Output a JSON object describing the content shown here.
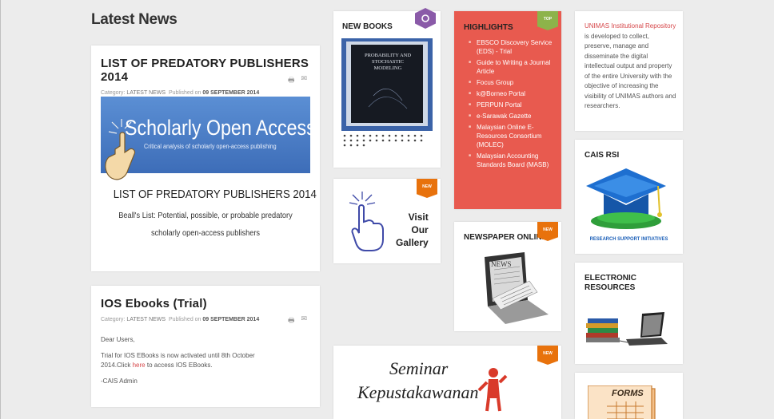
{
  "section_title": "Latest News",
  "articles": [
    {
      "title": "LIST OF PREDATORY PUBLISHERS 2014",
      "category_label": "Category:",
      "category": "LATEST NEWS",
      "published_label": "Published on",
      "date": "09 SEPTEMBER 2014",
      "image": {
        "banner_title": "Scholarly Open Access",
        "banner_subtitle": "Critical analysis of scholarly open-access publishing",
        "heading": "LIST OF PREDATORY PUBLISHERS 2014",
        "line1": "Beall's List: Potential, possible, or probable predatory",
        "line2": "scholarly open-access publishers"
      }
    },
    {
      "title": "IOS Ebooks (Trial)",
      "category_label": "Category:",
      "category": "LATEST NEWS",
      "published_label": "Published on",
      "date": "09 SEPTEMBER 2014",
      "greeting": "Dear Users,",
      "body_before": "Trial for IOS EBooks is now activated until 8th October 2014.Click",
      "link": "here",
      "body_after": "to access IOS EBooks.",
      "signature": "-CAIS Admin"
    }
  ],
  "new_books": {
    "title": "NEW BOOKS",
    "book_title": "PROBABILITY AND STOCHASTIC MODELING"
  },
  "gallery": {
    "badge": "NEW",
    "line1": "Visit",
    "line2": "Our",
    "line3": "Gallery"
  },
  "highlights": {
    "title": "HIGHLIGHTS",
    "badge": "TOP",
    "color": "#e85a4f",
    "items": [
      "EBSCO Discovery Service (EDS) - Trial",
      "Guide to Writing a Journal Article",
      "Focus Group",
      "k@Borneo Portal",
      "PERPUN Portal",
      "e-Sarawak Gazette",
      "Malaysian Online E-Resources Consortium (MOLEC)",
      "Malaysian Accounting Standards Board (MASB)"
    ]
  },
  "newspaper": {
    "title": "NEWSPAPER ONLINE",
    "badge": "NEW",
    "screen_text": "NEWS"
  },
  "seminar": {
    "badge": "NEW",
    "line1": "Seminar",
    "line2": "Kepustakawanan"
  },
  "repository": {
    "link_text": "UNIMAS Institutional Repository",
    "text": "is developed to collect, preserve, manage and disseminate the digital intellectual output and property of the entire University with the objective of increasing the visibility of UNIMAS authors and researchers."
  },
  "cais_rsi": {
    "title": "CAIS RSI",
    "caption": "RESEARCH SUPPORT INITIATIVES"
  },
  "electronic_resources": {
    "title_line1": "ELECTRONIC",
    "title_line2": "RESOURCES"
  },
  "forms": {
    "label": "FORMS"
  }
}
